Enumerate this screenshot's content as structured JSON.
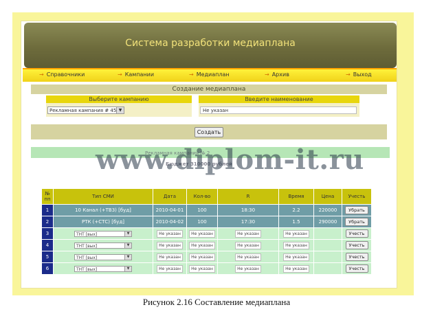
{
  "app": {
    "title": "Система разработки медиаплана"
  },
  "menu": [
    {
      "label": "Справочники"
    },
    {
      "label": "Кампании"
    },
    {
      "label": "Медиаплан"
    },
    {
      "label": "Архив"
    },
    {
      "label": "Выход"
    }
  ],
  "section_title": "Создание медиаплана",
  "campaign": {
    "header": "Выберите кампанию",
    "value": "Рекламная кампания # 45"
  },
  "name": {
    "header": "Введите наименование",
    "value": "Не указан"
  },
  "create_button": "Создать",
  "campaign_bar": {
    "text": "Рекламная кампания № 2",
    "budget": "Бюджет 310000 рублей"
  },
  "watermark": "www.diplom-it.ru",
  "table": {
    "headers": [
      "№ пп",
      "Тип СМИ",
      "Дата",
      "Кол-во",
      "R",
      "Время",
      "Цена",
      "Учесть"
    ],
    "rows": [
      {
        "num": "1",
        "media": "10 Канал (+ТВ3) [буд]",
        "date": "2010-04-01",
        "qty": "100",
        "r": "18:30",
        "time": "2.2",
        "price": "220000",
        "action": "Убрать",
        "filled": true
      },
      {
        "num": "2",
        "media": "РТК (+СТС) [буд]",
        "date": "2010-04-02",
        "qty": "100",
        "r": "17:30",
        "time": "1.5",
        "price": "290000",
        "action": "Убрать",
        "filled": true
      },
      {
        "num": "3",
        "media": "ТНТ [вых]",
        "date": "Не указан",
        "qty": "Не указан",
        "r": "Не указан",
        "time": "Не указан",
        "price": "",
        "action": "Учесть",
        "filled": false
      },
      {
        "num": "4",
        "media": "ТНТ [вых]",
        "date": "Не указан",
        "qty": "Не указан",
        "r": "Не указан",
        "time": "Не указан",
        "price": "",
        "action": "Учесть",
        "filled": false
      },
      {
        "num": "5",
        "media": "ТНТ [вых]",
        "date": "Не указан",
        "qty": "Не указан",
        "r": "Не указан",
        "time": "Не указан",
        "price": "",
        "action": "Учесть",
        "filled": false
      },
      {
        "num": "6",
        "media": "ТНТ [вых]",
        "date": "Не указан",
        "qty": "Не указан",
        "r": "Не указан",
        "time": "Не указан",
        "price": "",
        "action": "Учесть",
        "filled": false
      }
    ]
  },
  "caption": "Рисунок 2.16 Составление медиаплана"
}
